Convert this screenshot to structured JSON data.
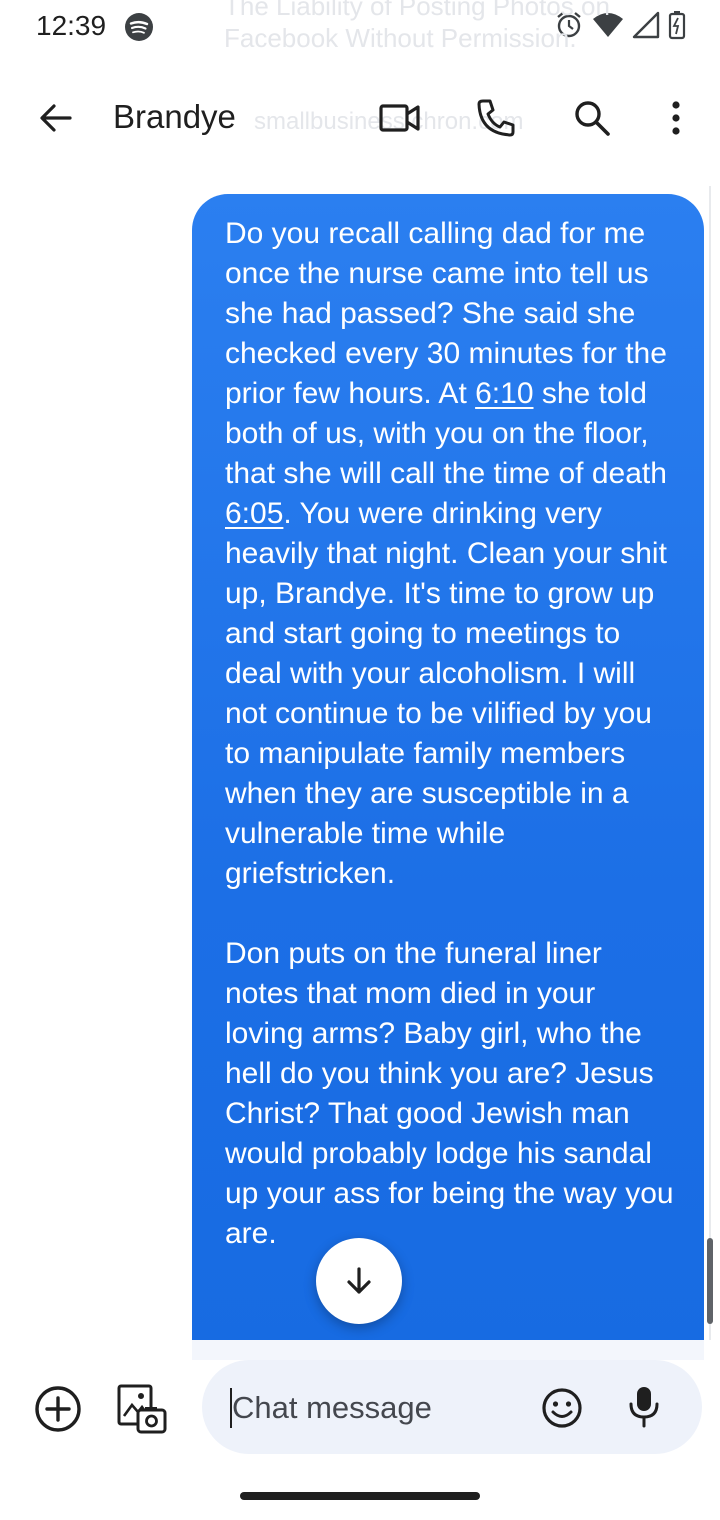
{
  "status_bar": {
    "time": "12:39",
    "icons": [
      "spotify-icon",
      "alarm-icon",
      "wifi-icon",
      "signal-icon",
      "battery-icon"
    ]
  },
  "background_preview": {
    "title": "The Liability of Posting Photos on Facebook Without Permission.",
    "domain": "smallbusiness.chron.com"
  },
  "toolbar": {
    "contact_name": "Brandye",
    "icons": [
      "back-arrow-icon",
      "video-camera-icon",
      "phone-icon",
      "search-icon",
      "more-vert-icon"
    ]
  },
  "conversation": {
    "message": {
      "part1": "Do you recall calling dad for me once the nurse came into tell us she had passed? She said she checked every 30 minutes for the prior few hours. At ",
      "link1": "6:10",
      "part2": " she told both of us, with you on the floor, that she will call the time of death ",
      "link2": "6:05",
      "part3": ". You were drinking very heavily that night. Clean your shit up, Brandye. It's time to grow up and start going to meetings to deal with your alcoholism. I will not continue to be vilified by you to manipulate family members when they are susceptible in a vulnerable time while griefstricken.\n\nDon puts on the funeral liner notes that mom died in your loving arms? Baby girl, who the hell do you think you are? Jesus Christ? That good Jewish man would probably lodge his sandal up your ass for being the way you are."
    },
    "bubble_color": "#1a73e8"
  },
  "compose": {
    "placeholder": "Chat message",
    "icons": [
      "add-circle-icon",
      "gallery-icon",
      "emoji-icon",
      "mic-icon"
    ]
  },
  "scroll_down_icon": "arrow-down-icon"
}
